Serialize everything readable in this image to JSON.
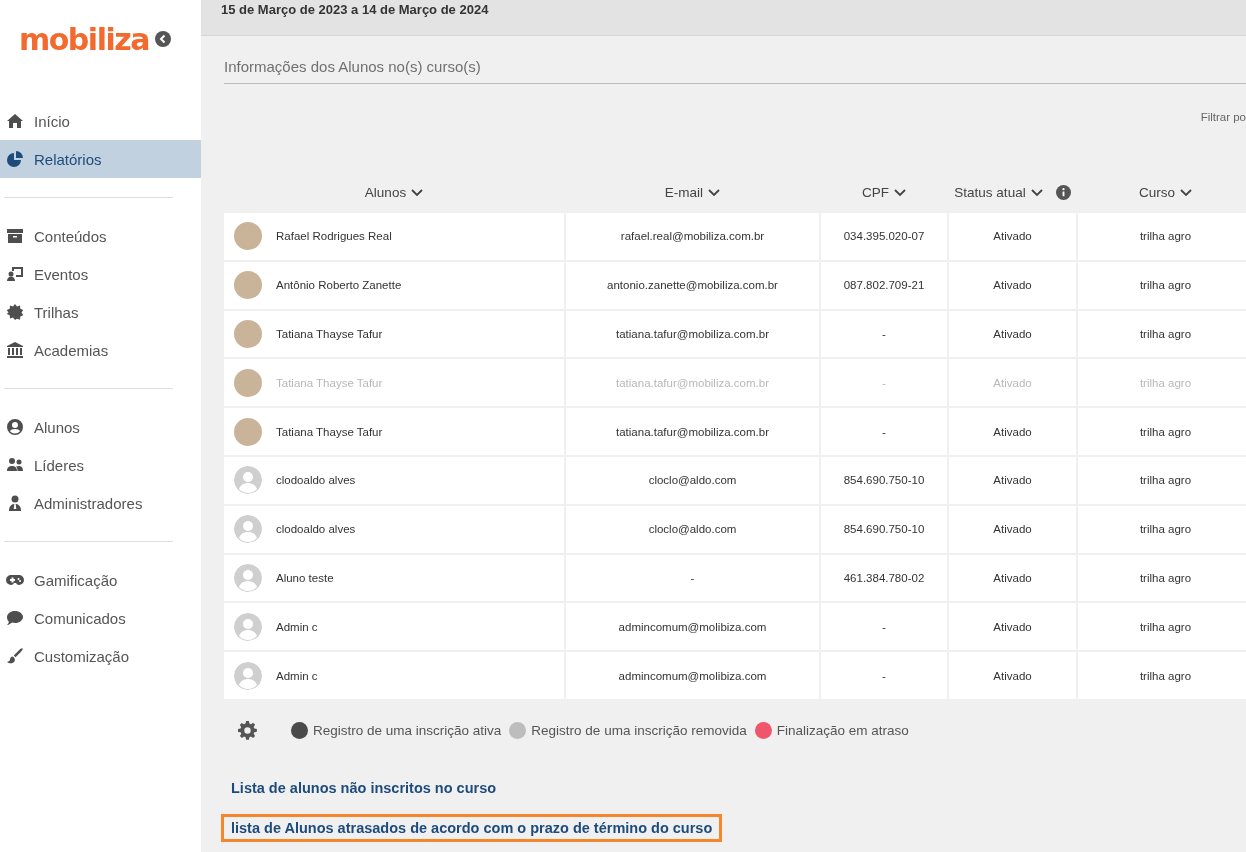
{
  "sidebar": {
    "logo": "mobiliza",
    "groups": [
      {
        "items": [
          {
            "label": "Início",
            "selected": false
          },
          {
            "label": "Relatórios",
            "selected": true
          }
        ]
      },
      {
        "items": [
          {
            "label": "Conteúdos",
            "selected": false
          },
          {
            "label": "Eventos",
            "selected": false
          },
          {
            "label": "Trilhas",
            "selected": false
          },
          {
            "label": "Academias",
            "selected": false
          }
        ]
      },
      {
        "items": [
          {
            "label": "Alunos",
            "selected": false
          },
          {
            "label": "Líderes",
            "selected": false
          },
          {
            "label": "Administradores",
            "selected": false
          }
        ]
      },
      {
        "items": [
          {
            "label": "Gamificação",
            "selected": false
          },
          {
            "label": "Comunicados",
            "selected": false
          },
          {
            "label": "Customização",
            "selected": false
          }
        ]
      }
    ]
  },
  "header": {
    "period": "15 de Março de 2023 a 14 de Março de 2024"
  },
  "section_title": "Informações dos Alunos no(s) curso(s)",
  "filter_label": "Filtrar po",
  "table": {
    "columns": [
      {
        "label": "Alunos",
        "info": false
      },
      {
        "label": "E-mail",
        "info": false
      },
      {
        "label": "CPF",
        "info": false
      },
      {
        "label": "Status atual",
        "info": true
      },
      {
        "label": "Curso",
        "info": false
      }
    ],
    "rows": [
      {
        "kind": "photo",
        "removed": false,
        "cells": [
          "Rafael Rodrigues Real",
          "rafael.real@mobiliza.com.br",
          "034.395.020-07",
          "Ativado",
          "trilha agro"
        ]
      },
      {
        "kind": "photo",
        "removed": false,
        "cells": [
          "Antônio Roberto Zanette",
          "antonio.zanette@mobiliza.com.br",
          "087.802.709-21",
          "Ativado",
          "trilha agro"
        ]
      },
      {
        "kind": "photo",
        "removed": false,
        "cells": [
          "Tatiana Thayse Tafur",
          "tatiana.tafur@mobiliza.com.br",
          "-",
          "Ativado",
          "trilha agro"
        ]
      },
      {
        "kind": "photo",
        "removed": true,
        "cells": [
          "Tatiana Thayse Tafur",
          "tatiana.tafur@mobiliza.com.br",
          "-",
          "Ativado",
          "trilha agro"
        ]
      },
      {
        "kind": "photo",
        "removed": false,
        "cells": [
          "Tatiana Thayse Tafur",
          "tatiana.tafur@mobiliza.com.br",
          "-",
          "Ativado",
          "trilha agro"
        ]
      },
      {
        "kind": "default",
        "removed": false,
        "cells": [
          "clodoaldo alves",
          "cloclo@aldo.com",
          "854.690.750-10",
          "Ativado",
          "trilha agro"
        ]
      },
      {
        "kind": "default",
        "removed": false,
        "cells": [
          "clodoaldo alves",
          "cloclo@aldo.com",
          "854.690.750-10",
          "Ativado",
          "trilha agro"
        ]
      },
      {
        "kind": "default",
        "removed": false,
        "cells": [
          "Aluno teste",
          "-",
          "461.384.780-02",
          "Ativado",
          "trilha agro"
        ]
      },
      {
        "kind": "default",
        "removed": false,
        "cells": [
          "Admin c",
          "admincomum@molibiza.com",
          "-",
          "Ativado",
          "trilha agro"
        ]
      },
      {
        "kind": "default",
        "removed": false,
        "cells": [
          "Admin c",
          "admincomum@molibiza.com",
          "-",
          "Ativado",
          "trilha agro"
        ]
      }
    ]
  },
  "legend": [
    {
      "label": "Registro de uma inscrição ativa",
      "color": "#4a4a4a"
    },
    {
      "label": "Registro de uma inscrição removida",
      "color": "#bdbdbd"
    },
    {
      "label": "Finalização em atraso",
      "color": "#f0566b"
    }
  ],
  "links": [
    {
      "label": "Lista de alunos não inscritos no curso",
      "outlined": false
    },
    {
      "label": "lista de Alunos atrasados de acordo com o prazo de término do curso",
      "outlined": true
    }
  ]
}
